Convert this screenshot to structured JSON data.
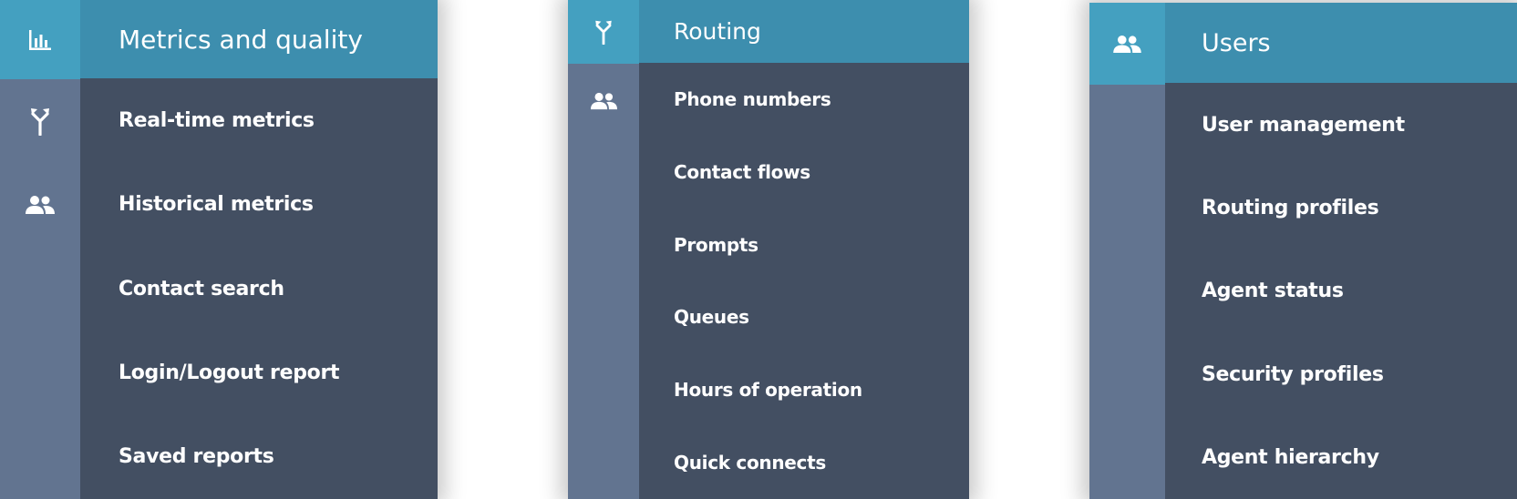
{
  "panels": [
    {
      "header": {
        "title": "Metrics and quality",
        "icon": "bar-chart-icon"
      },
      "rail_icons": [
        "routing-icon",
        "users-icon"
      ],
      "items": [
        "Real-time metrics",
        "Historical metrics",
        "Contact search",
        "Login/Logout report",
        "Saved reports"
      ]
    },
    {
      "header": {
        "title": "Routing",
        "icon": "routing-icon"
      },
      "rail_icons": [
        "users-icon"
      ],
      "items": [
        "Phone numbers",
        "Contact flows",
        "Prompts",
        "Queues",
        "Hours of operation",
        "Quick connects"
      ]
    },
    {
      "header": {
        "title": "Users",
        "icon": "users-icon"
      },
      "rail_icons": [],
      "items": [
        "User management",
        "Routing profiles",
        "Agent status",
        "Security profiles",
        "Agent hierarchy"
      ]
    }
  ],
  "colors": {
    "rail": "#627490",
    "rail_active": "#44a0c0",
    "menu": "#434f62",
    "header": "#3d8eae",
    "text": "#ffffff"
  }
}
